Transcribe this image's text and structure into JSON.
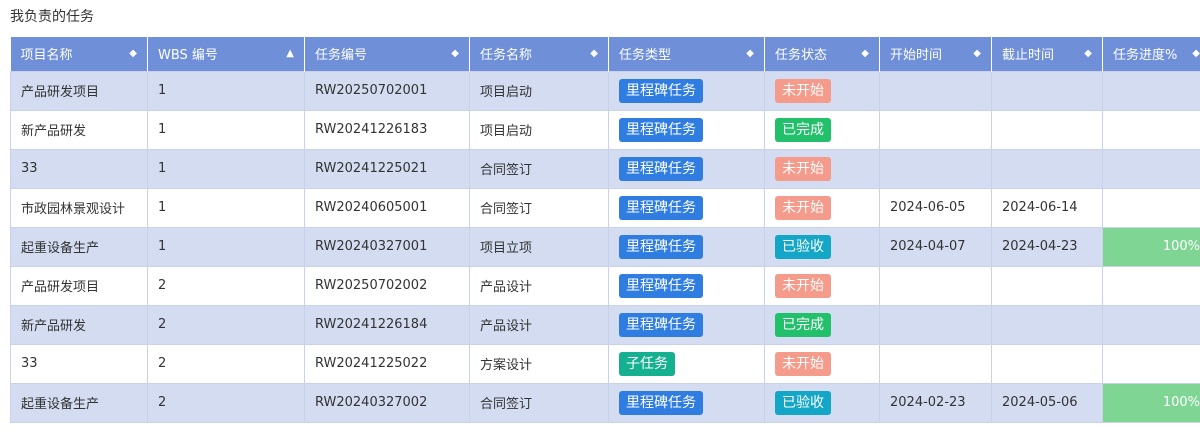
{
  "page": {
    "title": "我负责的任务"
  },
  "colors": {
    "header_bg": "#6f8fd8",
    "row_alt_bg": "#d3dcf0",
    "milestone": "#2f7de1",
    "subtask": "#14b08f",
    "not_started": "#f59b8c",
    "done": "#22c06b",
    "accepted": "#13a6c6",
    "progress_full": "#7fd694"
  },
  "columns": [
    {
      "label": "项目名称",
      "sort": "both"
    },
    {
      "label": "WBS 编号",
      "sort": "asc"
    },
    {
      "label": "任务编号",
      "sort": "both"
    },
    {
      "label": "任务名称",
      "sort": "both"
    },
    {
      "label": "任务类型",
      "sort": "both"
    },
    {
      "label": "任务状态",
      "sort": "both"
    },
    {
      "label": "开始时间",
      "sort": "both"
    },
    {
      "label": "截止时间",
      "sort": "both"
    },
    {
      "label": "任务进度%",
      "sort": "both"
    }
  ],
  "rows": [
    {
      "project": "产品研发项目",
      "wbs": "1",
      "task_no": "RW20250702001",
      "task_name": "项目启动",
      "type": "里程碑任务",
      "type_kind": "milestone",
      "status": "未开始",
      "status_kind": "not-started",
      "start": "",
      "end": "",
      "progress": ""
    },
    {
      "project": "新产品研发",
      "wbs": "1",
      "task_no": "RW20241226183",
      "task_name": "项目启动",
      "type": "里程碑任务",
      "type_kind": "milestone",
      "status": "已完成",
      "status_kind": "done",
      "start": "",
      "end": "",
      "progress": ""
    },
    {
      "project": "33",
      "wbs": "1",
      "task_no": "RW20241225021",
      "task_name": "合同签订",
      "type": "里程碑任务",
      "type_kind": "milestone",
      "status": "未开始",
      "status_kind": "not-started",
      "start": "",
      "end": "",
      "progress": ""
    },
    {
      "project": "市政园林景观设计",
      "wbs": "1",
      "task_no": "RW20240605001",
      "task_name": "合同签订",
      "type": "里程碑任务",
      "type_kind": "milestone",
      "status": "未开始",
      "status_kind": "not-started",
      "start": "2024-06-05",
      "end": "2024-06-14",
      "progress": ""
    },
    {
      "project": "起重设备生产",
      "wbs": "1",
      "task_no": "RW20240327001",
      "task_name": "项目立项",
      "type": "里程碑任务",
      "type_kind": "milestone",
      "status": "已验收",
      "status_kind": "accepted",
      "start": "2024-04-07",
      "end": "2024-04-23",
      "progress": "100%"
    },
    {
      "project": "产品研发项目",
      "wbs": "2",
      "task_no": "RW20250702002",
      "task_name": "产品设计",
      "type": "里程碑任务",
      "type_kind": "milestone",
      "status": "未开始",
      "status_kind": "not-started",
      "start": "",
      "end": "",
      "progress": ""
    },
    {
      "project": "新产品研发",
      "wbs": "2",
      "task_no": "RW20241226184",
      "task_name": "产品设计",
      "type": "里程碑任务",
      "type_kind": "milestone",
      "status": "已完成",
      "status_kind": "done",
      "start": "",
      "end": "",
      "progress": ""
    },
    {
      "project": "33",
      "wbs": "2",
      "task_no": "RW20241225022",
      "task_name": "方案设计",
      "type": "子任务",
      "type_kind": "subtask",
      "status": "未开始",
      "status_kind": "not-started",
      "start": "",
      "end": "",
      "progress": ""
    },
    {
      "project": "起重设备生产",
      "wbs": "2",
      "task_no": "RW20240327002",
      "task_name": "合同签订",
      "type": "里程碑任务",
      "type_kind": "milestone",
      "status": "已验收",
      "status_kind": "accepted",
      "start": "2024-02-23",
      "end": "2024-05-06",
      "progress": "100%"
    }
  ]
}
